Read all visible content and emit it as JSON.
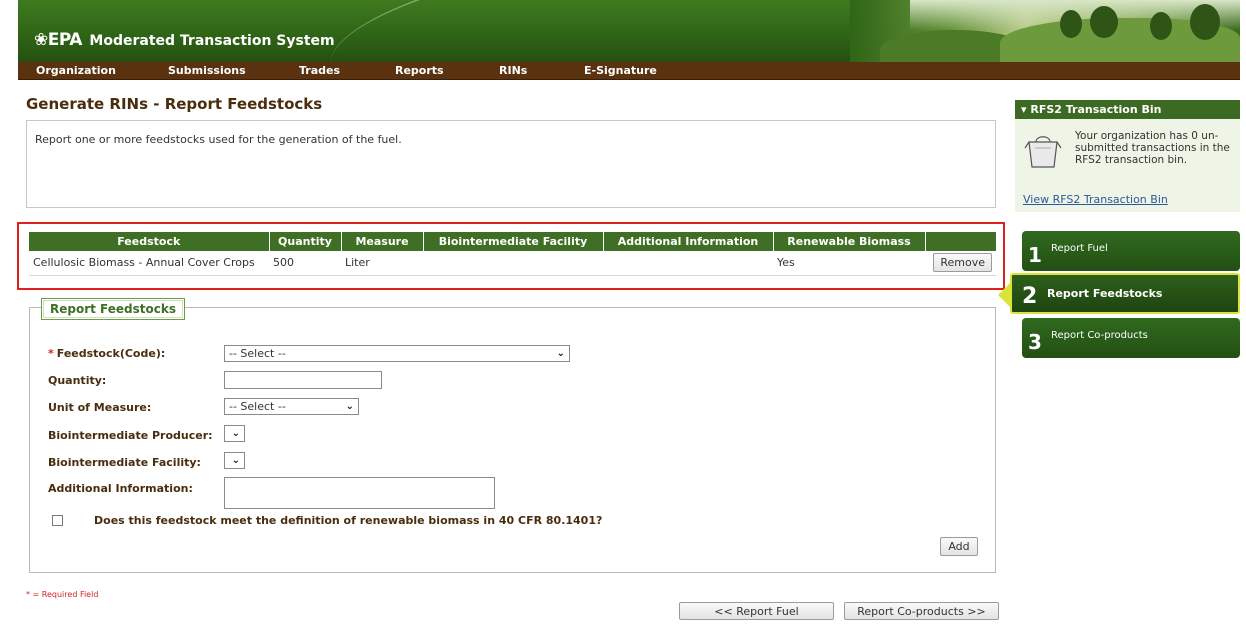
{
  "header": {
    "logo_text": "EPA",
    "app_title": "Moderated Transaction System"
  },
  "nav": {
    "items": [
      {
        "label": "Organization"
      },
      {
        "label": "Submissions"
      },
      {
        "label": "Trades"
      },
      {
        "label": "Reports"
      },
      {
        "label": "RINs"
      },
      {
        "label": "E-Signature"
      }
    ]
  },
  "page": {
    "title": "Generate RINs - Report Feedstocks",
    "description": "Report one or more feedstocks used for the generation of the fuel."
  },
  "feedstock_table": {
    "columns": [
      "Feedstock",
      "Quantity",
      "Measure",
      "Biointermediate Facility",
      "Additional Information",
      "Renewable Biomass",
      ""
    ],
    "rows": [
      {
        "feedstock": "Cellulosic Biomass - Annual Cover Crops",
        "quantity": "500",
        "measure": "Liter",
        "biointermediate_facility": "",
        "additional_information": "",
        "renewable_biomass": "Yes",
        "remove_label": "Remove"
      }
    ]
  },
  "form": {
    "legend": "Report Feedstocks",
    "required_marker": "*",
    "feedstock_label": "Feedstock(Code):",
    "feedstock_value": "-- Select --",
    "quantity_label": "Quantity:",
    "quantity_value": "",
    "unit_label": "Unit of Measure:",
    "unit_value": "-- Select --",
    "producer_label": "Biointermediate Producer:",
    "producer_value": "",
    "facility_label": "Biointermediate Facility:",
    "facility_value": "",
    "additional_label": "Additional Information:",
    "additional_value": "",
    "biomass_question": "Does this feedstock meet the definition of renewable biomass in 40 CFR 80.1401?",
    "add_label": "Add"
  },
  "footer": {
    "required_note": "* = Required Field",
    "prev_label": "<< Report Fuel",
    "next_label": "Report Co-products >>"
  },
  "sidebar": {
    "bin_title": "RFS2 Transaction Bin",
    "bin_text": "Your organization has 0 un-submitted transactions in the RFS2 transaction bin.",
    "bin_link": "View RFS2 Transaction Bin",
    "steps": [
      {
        "num": "1",
        "label": "Report Fuel"
      },
      {
        "num": "2",
        "label": "Report Feedstocks"
      },
      {
        "num": "3",
        "label": "Report Co-products"
      }
    ]
  },
  "colors": {
    "header_green": "#2f6516",
    "nav_brown": "#5a3210",
    "title_brown": "#4a2d0d",
    "table_header_green": "#3f6f25",
    "highlight_red": "#e0201c",
    "active_step_border": "#d9e33a",
    "required_red": "#d1261f"
  }
}
